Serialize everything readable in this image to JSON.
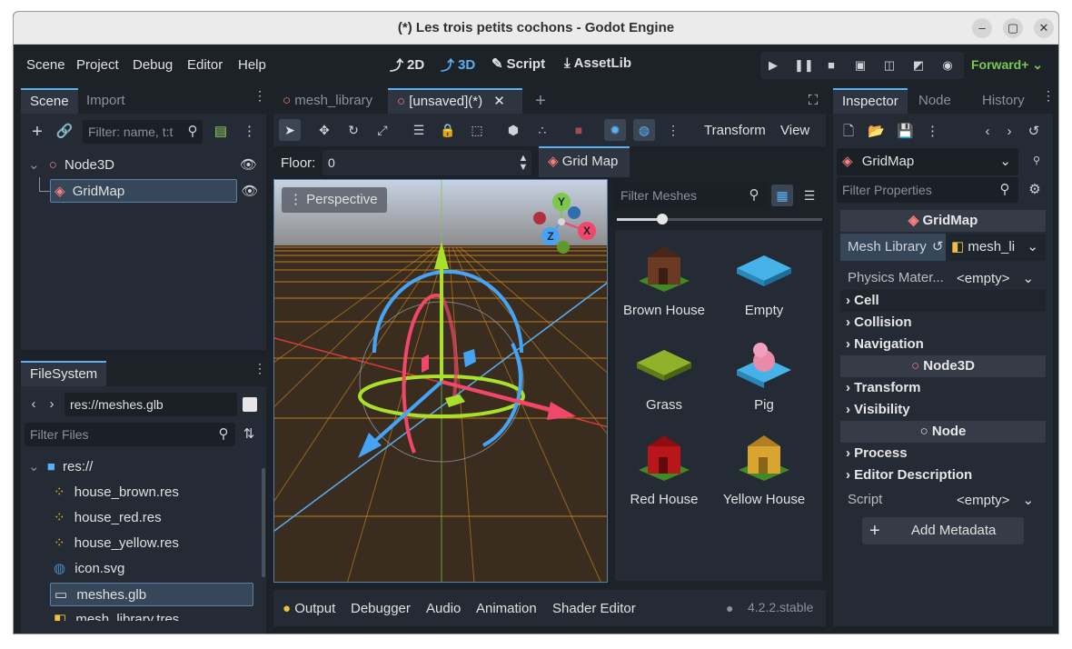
{
  "window": {
    "title": "(*) Les trois petits cochons - Godot Engine"
  },
  "menu": [
    "Scene",
    "Project",
    "Debug",
    "Editor",
    "Help"
  ],
  "workspaces": [
    {
      "label": "2D",
      "icon": "2d-icon"
    },
    {
      "label": "3D",
      "icon": "3d-icon"
    },
    {
      "label": "Script",
      "icon": "script-icon"
    },
    {
      "label": "AssetLib",
      "icon": "assetlib-icon"
    }
  ],
  "renderer": "Forward+",
  "scene_dock": {
    "tabs": [
      "Scene",
      "Import"
    ],
    "filter_placeholder": "Filter: name, t:t",
    "tree": [
      {
        "label": "Node3D",
        "icon": "node3d-icon"
      },
      {
        "label": "GridMap",
        "icon": "gridmap-icon"
      }
    ]
  },
  "filesystem": {
    "tab": "FileSystem",
    "path": "res://meshes.glb",
    "filter_placeholder": "Filter Files",
    "items": [
      {
        "label": "res://",
        "icon": "folder-icon"
      },
      {
        "label": "house_brown.res",
        "icon": "mesh-resource-icon"
      },
      {
        "label": "house_red.res",
        "icon": "mesh-resource-icon"
      },
      {
        "label": "house_yellow.res",
        "icon": "mesh-resource-icon"
      },
      {
        "label": "icon.svg",
        "icon": "godot-svg-icon"
      },
      {
        "label": "meshes.glb",
        "icon": "scene-file-icon"
      },
      {
        "label": "mesh_library.tres",
        "icon": "mesh-library-icon"
      }
    ]
  },
  "editor_tabs": [
    {
      "label": "mesh_library"
    },
    {
      "label": "[unsaved](*)"
    }
  ],
  "viewport_toolbar": {
    "transform": "Transform",
    "view": "View"
  },
  "gridmap_bar": {
    "floor_label": "Floor:",
    "floor_value": "0",
    "gridmap_button": "Grid Map"
  },
  "viewport": {
    "perspective": "Perspective"
  },
  "gizmo": {
    "x": "X",
    "y": "Y",
    "z": "Z"
  },
  "mesh_palette": {
    "filter_placeholder": "Filter Meshes",
    "items": [
      {
        "label": "Brown House",
        "color": "#6b3a22"
      },
      {
        "label": "Empty",
        "color": "#45b3e7"
      },
      {
        "label": "Grass",
        "color": "#8fb22a"
      },
      {
        "label": "Pig",
        "color": "#e88aa8"
      },
      {
        "label": "Red House",
        "color": "#b8161b"
      },
      {
        "label": "Yellow House",
        "color": "#d9a430"
      }
    ]
  },
  "bottom_panel": {
    "tabs": [
      "Output",
      "Debugger",
      "Audio",
      "Animation",
      "Shader Editor"
    ],
    "version": "4.2.2.stable"
  },
  "inspector": {
    "tabs": [
      "Inspector",
      "Node",
      "History"
    ],
    "node_select": "GridMap",
    "filter_placeholder": "Filter Properties",
    "class_header": "GridMap",
    "mesh_library_label": "Mesh Library",
    "mesh_library_value": "mesh_li",
    "physics_label": "Physics Mater...",
    "physics_value": "<empty>",
    "sections_gridmap": [
      "Cell",
      "Collision",
      "Navigation"
    ],
    "node3d_header": "Node3D",
    "sections_node3d": [
      "Transform",
      "Visibility"
    ],
    "node_header": "Node",
    "sections_node": [
      "Process",
      "Editor Description"
    ],
    "script_label": "Script",
    "script_value": "<empty>",
    "add_metadata": "Add Metadata"
  },
  "colors": {
    "accent": "#5aaff5",
    "godot_node": "#fc7f7f",
    "renderer": "#7bc84b"
  }
}
